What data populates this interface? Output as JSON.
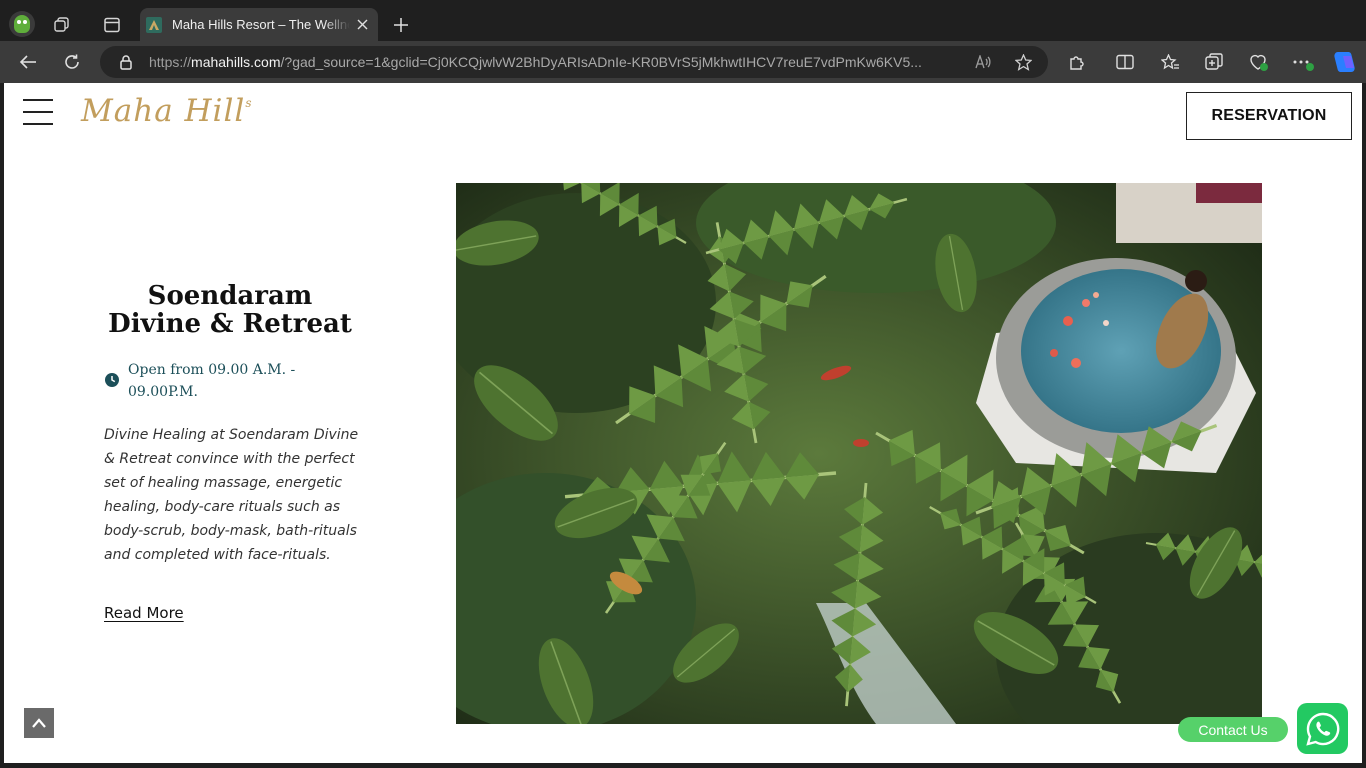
{
  "browser": {
    "tab": {
      "title": "Maha Hills Resort – The Wellness"
    },
    "address": {
      "scheme": "https://",
      "domain": "mahahills.com",
      "rest": "/?gad_source=1&gclid=Cj0KCQjwlvW2BhDyARIsADnIe-KR0BVrS5jMkhwtIHCV7reuE7vdPmKw6KV5..."
    },
    "icons": [
      "profile-avatar",
      "workspaces-icon",
      "tab-actions-icon",
      "tab-favicon",
      "close-tab-icon",
      "new-tab-icon",
      "back-icon",
      "refresh-icon",
      "lock-icon",
      "read-aloud-icon",
      "favorite-star-icon",
      "extensions-icon",
      "split-screen-icon",
      "favorites-icon",
      "collections-icon",
      "browser-essentials-icon",
      "more-options-icon",
      "copilot-icon"
    ]
  },
  "header": {
    "logo_text": "Maha Hill",
    "logo_sup": "s",
    "reservation_label": "RESERVATION"
  },
  "feature": {
    "title_line1": "Soendaram",
    "title_line2": "Divine & Retreat",
    "hours_line1": "Open from 09.00 A.M. -",
    "hours_line2": "09.00P.M.",
    "description": "Divine Healing at Soendaram Divine & Retreat convince with the perfect set of healing massage, energetic healing, body-care rituals such as body-scrub, body-mask, bath-rituals and completed with face-rituals.",
    "read_more": "Read More"
  },
  "widgets": {
    "contact_label": "Contact Us"
  },
  "colors": {
    "logo_gold": "#c29e5d",
    "hours_teal": "#1c4f59",
    "whatsapp_green": "#23c962",
    "contact_green": "#56d16a"
  }
}
